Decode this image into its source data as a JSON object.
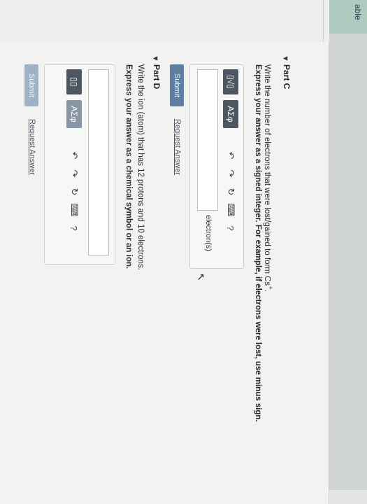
{
  "sidebar": {
    "tab_label": "able"
  },
  "part_c": {
    "title": "Part C",
    "question": "Write the number of electrons that were lost/gained to form Cs",
    "superscript": "+",
    "question_end": ".",
    "instruction": "Express your answer as a signed integer. For example, if electrons were lost, use minus sign.",
    "toolbar": {
      "template_label": "▯√▯",
      "greek_label": "ΑΣφ"
    },
    "unit": "electron(s)",
    "submit_label": "Submit",
    "request_label": "Request Answer"
  },
  "part_d": {
    "title": "Part D",
    "question": "Write the ion (atom) that has 12 protons and 10 electrons.",
    "instruction": "Express your answer as a chemical symbol or an ion.",
    "toolbar": {
      "template_label": "▯▯",
      "greek_label": "ΑΣφ"
    },
    "submit_label": "Submit",
    "request_label": "Request Answer"
  },
  "icons": {
    "undo": "↶",
    "redo": "↷",
    "reset": "↻",
    "keyboard": "⌨",
    "help": "?"
  }
}
